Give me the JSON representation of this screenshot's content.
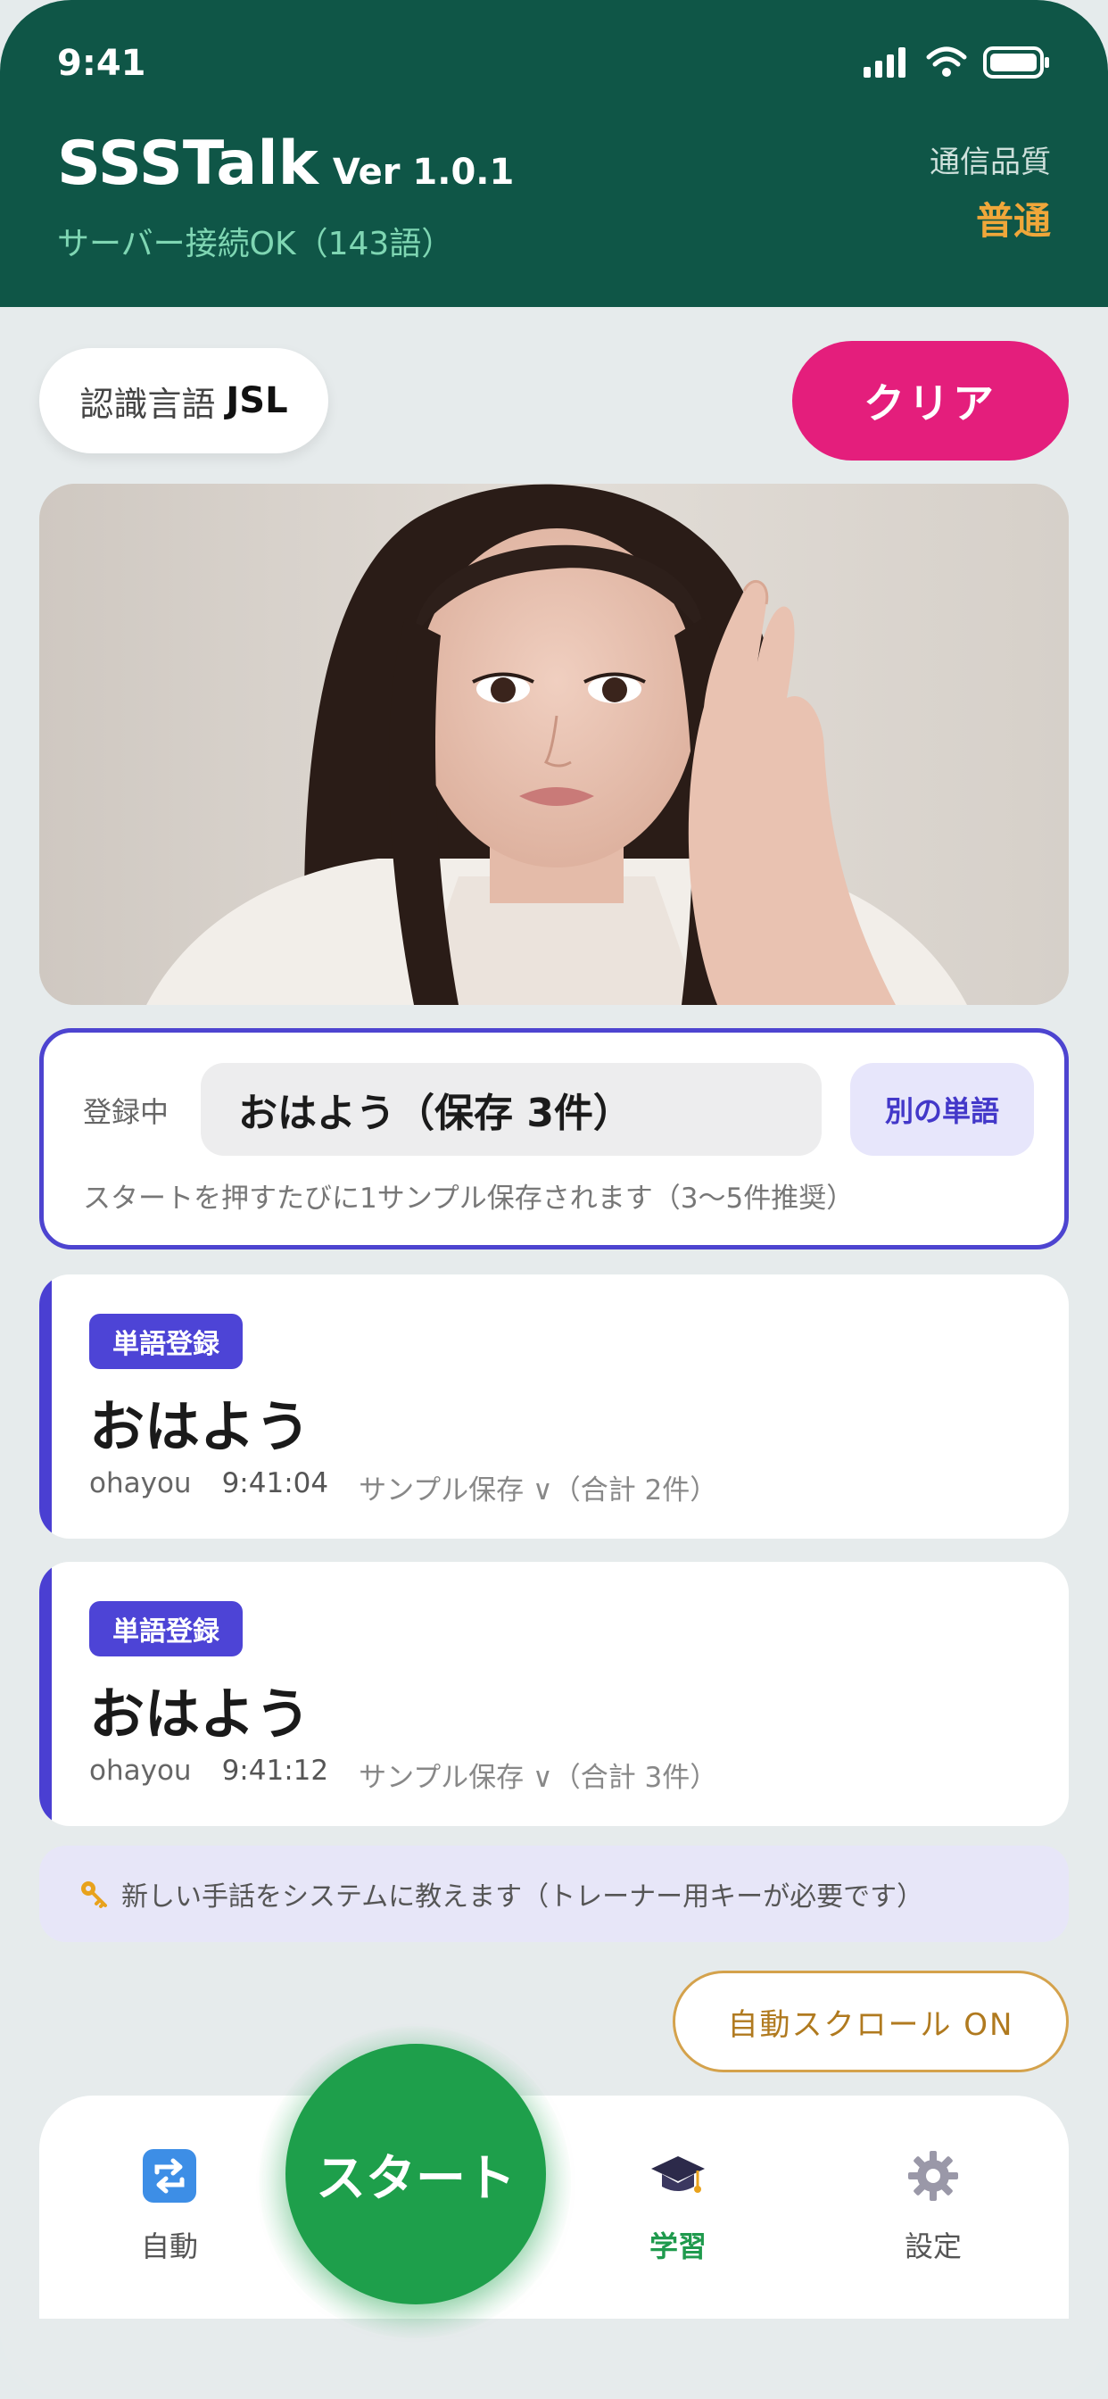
{
  "status_bar": {
    "time": "9:41"
  },
  "header": {
    "app_name": "SSSTalk",
    "version": "Ver 1.0.1",
    "server_status": "サーバー接続OK（143語）",
    "quality_label": "通信品質",
    "quality_value": "普通"
  },
  "controls": {
    "lang_label": "認識言語",
    "lang_value": "JSL",
    "clear_label": "クリア"
  },
  "registering": {
    "label": "登録中",
    "word": "おはよう（保存 3件）",
    "other_word_label": "別の単語",
    "hint": "スタートを押すたびに1サンプル保存されます（3〜5件推奨）"
  },
  "entries": [
    {
      "badge": "単語登録",
      "word": "おはよう",
      "romaji": "ohayou",
      "time": "9:41:04",
      "status": "サンプル保存 ∨（合計 2件）"
    },
    {
      "badge": "単語登録",
      "word": "おはよう",
      "romaji": "ohayou",
      "time": "9:41:12",
      "status": "サンプル保存 ∨（合計 3件）"
    }
  ],
  "notice": {
    "icon": "key-icon",
    "text": "新しい手話をシステムに教えます（トレーナー用キーが必要です）"
  },
  "autoscroll_label": "自動スクロール ON",
  "nav": {
    "start_label": "スタート",
    "items": [
      {
        "label": "自動",
        "icon": "repeat-icon"
      },
      {
        "label": "学習",
        "icon": "graduation-cap-icon"
      },
      {
        "label": "設定",
        "icon": "gear-icon"
      }
    ]
  },
  "colors": {
    "header_bg": "#0f5647",
    "accent_pink": "#e41e7c",
    "accent_purple": "#4d44d0",
    "start_green": "#1e9f4b",
    "quality_orange": "#f0a73a"
  }
}
